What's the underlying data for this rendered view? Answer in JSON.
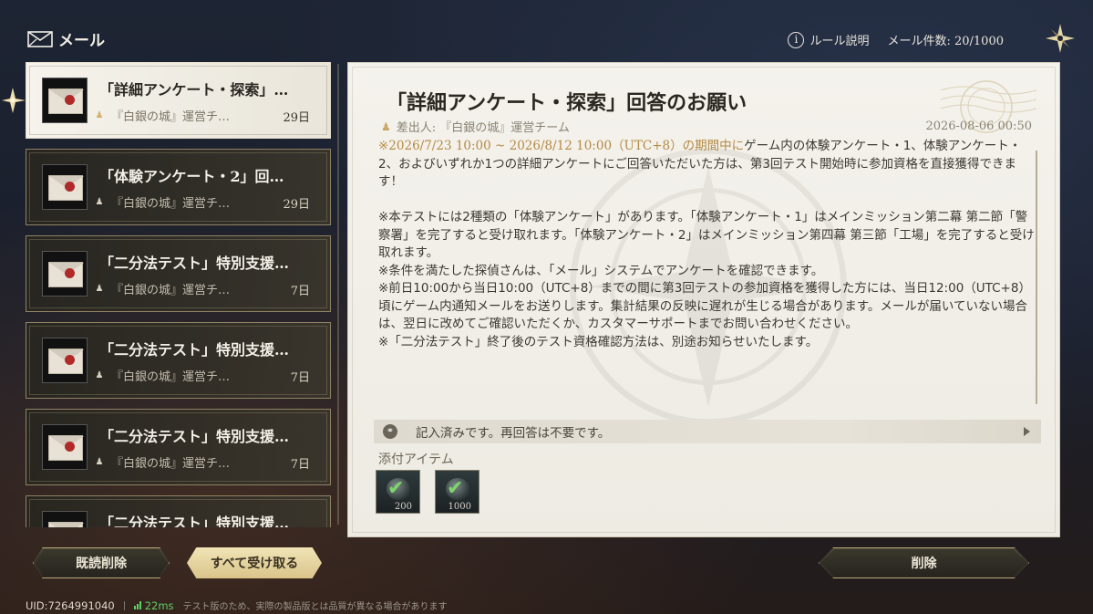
{
  "header": {
    "title": "メール",
    "rules_label": "ルール説明",
    "mail_count_label": "メール件数: 20/1000"
  },
  "mails": [
    {
      "title": "「詳細アンケート・探索」…",
      "sender": "『白銀の城』運営チ…",
      "days": "29日",
      "selected": true
    },
    {
      "title": "「体験アンケート・2」回…",
      "sender": "『白銀の城』運営チ…",
      "days": "29日",
      "selected": false
    },
    {
      "title": "「二分法テスト」特別支援…",
      "sender": "『白銀の城』運営チ…",
      "days": "7日",
      "selected": false
    },
    {
      "title": "「二分法テスト」特別支援…",
      "sender": "『白銀の城』運営チ…",
      "days": "7日",
      "selected": false
    },
    {
      "title": "「二分法テスト」特別支援…",
      "sender": "『白銀の城』運営チ…",
      "days": "7日",
      "selected": false
    },
    {
      "title": "「二分法テスト」特別支援…",
      "sender": "",
      "days": "",
      "selected": false
    }
  ],
  "detail": {
    "title": "「詳細アンケート・探索」回答のお願い",
    "sender": "差出人: 『白銀の城』運営チーム",
    "date": "2026-08-06 00:50",
    "body": {
      "p1_highlight": "※2026/7/23 10:00 ~ 2026/8/12 10:00（UTC+8）の期間中に",
      "p1_rest": "ゲーム内の体験アンケート・1、体験アンケート・2、およびいずれか1つの詳細アンケートにご回答いただいた方は、第3回テスト開始時に参加資格を直接獲得できます！",
      "p2": "※本テストには2種類の「体験アンケート」があります。「体験アンケート・1」はメインミッション第二幕 第二節「警察署」を完了すると受け取れます。「体験アンケート・2」はメインミッション第四幕 第三節「工場」を完了すると受け取れます。",
      "p3": "※条件を満たした探偵さんは、「メール」システムでアンケートを確認できます。",
      "p4": "※前日10:00から当日10:00（UTC+8）までの間に第3回テストの参加資格を獲得した方には、当日12:00（UTC+8）頃にゲーム内通知メールをお送りします。集計結果の反映に遅れが生じる場合があります。メールが届いていない場合は、翌日に改めてご確認いただくか、カスタマーサポートまでお問い合わせください。",
      "p5": "※「二分法テスト」終了後のテスト資格確認方法は、別途お知らせいたします。"
    },
    "status_text": "記入済みです。再回答は不要です。",
    "attachments_label": "添付アイテム",
    "attachments": [
      {
        "qty": "200",
        "claimed": true
      },
      {
        "qty": "1000",
        "claimed": true
      }
    ]
  },
  "buttons": {
    "delete_read": "既読削除",
    "claim_all": "すべて受け取る",
    "delete": "削除"
  },
  "footer": {
    "uid": "UID:7264991040",
    "ping": "22ms",
    "disclaimer": "テスト版のため、実際の製品版とは品質が異なる場合があります"
  },
  "colors": {
    "accent_gold": "#d9c48a",
    "highlight_text": "#b48a45",
    "ping_green": "#5fcf6a",
    "claimed_check": "#7fd66a"
  },
  "icons": [
    "mail-icon",
    "info-icon",
    "compass-icon",
    "envelope-icon",
    "person-icon",
    "link-icon",
    "check-icon"
  ]
}
